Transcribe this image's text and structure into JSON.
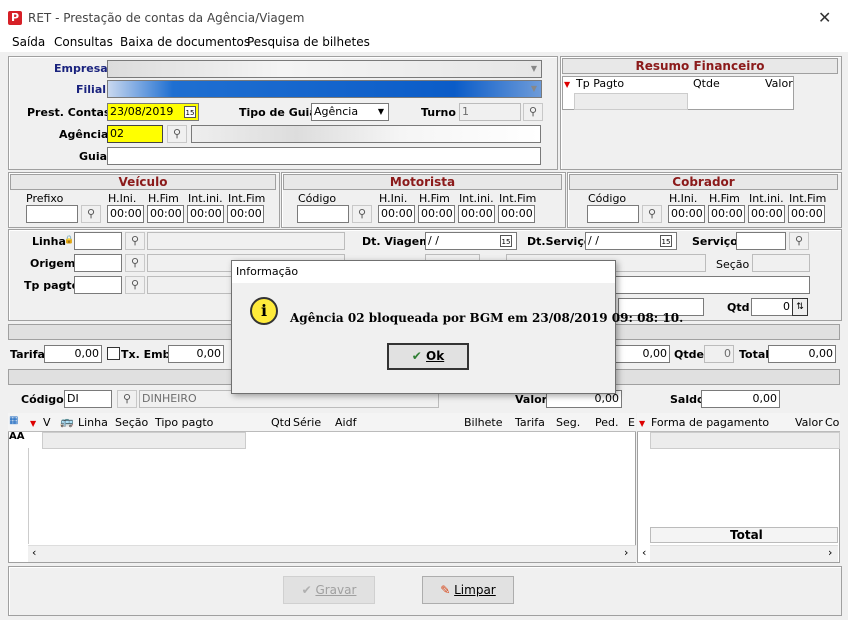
{
  "window": {
    "title": "RET - Prestação de contas da Agência/Viagem"
  },
  "menu": [
    "Saída",
    "Consultas",
    "Baixa de documentos",
    "Pesquisa de bilhetes"
  ],
  "header": {
    "empresa_label": "Empresa",
    "filial_label": "Filial",
    "prest_label": "Prest. Contas",
    "prest_value": "23/08/2019",
    "tipo_label": "Tipo de Guia",
    "tipo_value": "Agência",
    "turno_label": "Turno",
    "turno_value": "1",
    "agencia_label": "Agência",
    "agencia_value": "02",
    "guia_label": "Guia"
  },
  "resumo": {
    "title": "Resumo Financeiro",
    "cols": [
      "Tp Pagto",
      "Qtde",
      "Valor"
    ]
  },
  "veiculo": {
    "title": "Veículo",
    "prefixo": "Prefixo",
    "hini": "H.Ini.",
    "hfim": "H.Fim",
    "intini": "Int.ini.",
    "intfim": "Int.Fim",
    "time": "00:00"
  },
  "motorista": {
    "title": "Motorista",
    "codigo": "Código",
    "hini": "H.Ini.",
    "hfim": "H.Fim",
    "intini": "Int.ini.",
    "intfim": "Int.Fim"
  },
  "cobrador": {
    "title": "Cobrador",
    "codigo": "Código",
    "hini": "H.Ini.",
    "hfim": "H.Fim",
    "intini": "Int.ini.",
    "intfim": "Int.Fim"
  },
  "viagem": {
    "linha_label": "Linha",
    "origem_label": "Origem",
    "tppagto_label": "Tp pagto",
    "dtviagem_label": "Dt. Viagem",
    "dtviagem_value": " / /",
    "dtservico_label": "Dt.Serviço",
    "dtservico_value": " / /",
    "servico_label": "Serviço",
    "secao_label": "Seção",
    "qtd_label": "Qtd",
    "qtd_value": "0"
  },
  "tarifa": {
    "tarifa_label": "Tarifa",
    "tarifa_value": "0,00",
    "txemb_label": "Tx. Emb",
    "txemb_value": "0,00",
    "val3": "0,00",
    "qtde_label": "Qtde",
    "qtde_value": "0",
    "total_label": "Total",
    "total_value": "0,00"
  },
  "pagamento": {
    "codigo_label": "Código",
    "codigo_value": "DI",
    "desc_value": "DINHEIRO",
    "valor_label": "Valor",
    "valor_value": "0,00",
    "saldo_label": "Saldo",
    "saldo_value": "0,00"
  },
  "grid_left": {
    "cols": [
      "V",
      "Linha",
      "Seção",
      "Tipo pagto",
      "Qtd",
      "Série",
      "Aidf",
      "Bilhete",
      "Tarifa",
      "Seg.",
      "Ped.",
      "E"
    ]
  },
  "grid_right": {
    "cols": [
      "Forma de pagamento",
      "Valor",
      "Co"
    ],
    "total_label": "Total"
  },
  "buttons": {
    "gravar": "Gravar",
    "limpar": "Limpar"
  },
  "dialog": {
    "title": "Informação",
    "message": "Agência 02 bloqueada por BGM em 23/08/2019 09: 08: 10.",
    "ok": "Ok"
  },
  "colors": {
    "section_title": "#8b1a1a",
    "highlight": "#ffff00",
    "selection": "#0078d7"
  }
}
